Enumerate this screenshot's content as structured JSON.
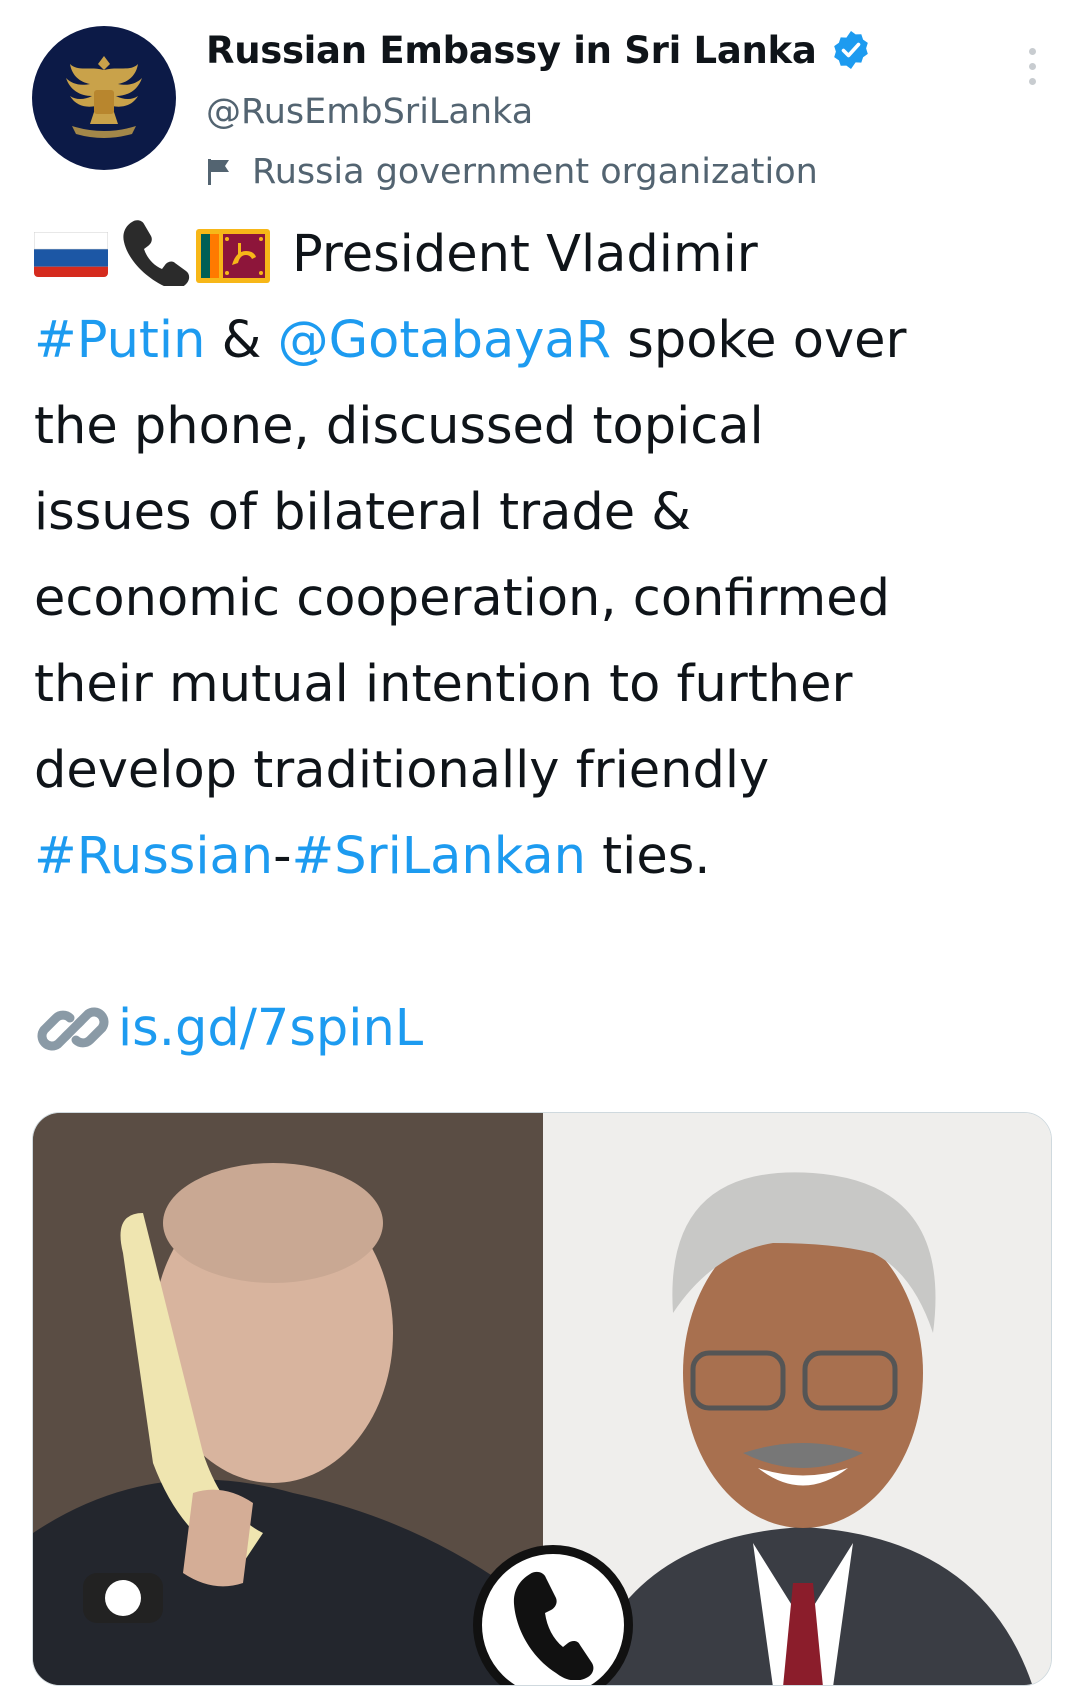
{
  "account": {
    "display_name": "Russian Embassy in Sri Lanka",
    "handle": "@RusEmbSriLanka",
    "label": "Russia government organization",
    "verified": true
  },
  "tweet": {
    "emoji": [
      "russia-flag",
      "telephone-receiver",
      "sri-lanka-flag"
    ],
    "line1_text": "President Vladimir",
    "hashtag_putin": "#Putin",
    "amp1": " & ",
    "mention_gotabaya": "@GotabayaR",
    "line2_rest": " spoke over",
    "line3": "the phone, discussed topical",
    "line4": "issues of bilateral trade &",
    "line5": "economic cooperation, confirmed",
    "line6": "their mutual intention to further",
    "line7": "develop traditionally friendly",
    "hashtag_russian": "#Russian",
    "dash": "-",
    "hashtag_srilankan": "#SriLankan",
    "line8_rest": " ties.",
    "url_text": "is.gd/7spinL"
  },
  "colors": {
    "link": "#1d9bf0",
    "text": "#0f1419",
    "secondary": "#536471",
    "avatar_bg": "#0c1a47",
    "verified": "#1d9bf0"
  },
  "media": {
    "icons": [
      "telephone-icon"
    ]
  }
}
